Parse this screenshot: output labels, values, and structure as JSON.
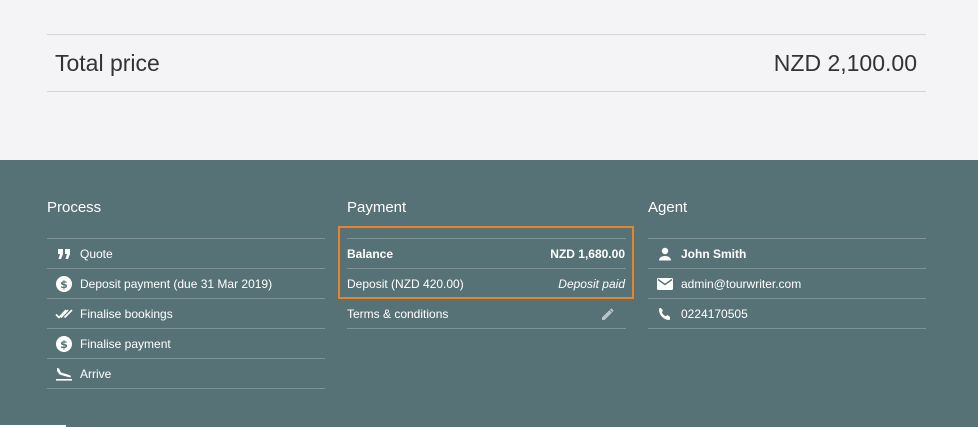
{
  "summary": {
    "total_label": "Total price",
    "total_value": "NZD 2,100.00"
  },
  "process": {
    "title": "Process",
    "items": [
      {
        "icon": "quote-icon",
        "label": "Quote"
      },
      {
        "icon": "dollar-circle-icon",
        "label": "Deposit payment (due 31 Mar 2019)"
      },
      {
        "icon": "double-check-icon",
        "label": "Finalise bookings"
      },
      {
        "icon": "dollar-circle-icon",
        "label": "Finalise payment"
      },
      {
        "icon": "plane-landing-icon",
        "label": "Arrive"
      }
    ]
  },
  "payment": {
    "title": "Payment",
    "balance_label": "Balance",
    "balance_value": "NZD 1,680.00",
    "deposit_label": "Deposit (NZD 420.00)",
    "deposit_status": "Deposit paid",
    "terms_label": "Terms & conditions"
  },
  "agent": {
    "title": "Agent",
    "name": "John Smith",
    "email": "admin@tourwriter.com",
    "phone": "0224170505"
  },
  "colors": {
    "footer_bg": "#577277",
    "highlight": "#e9832a",
    "page_bg": "#f4f4f6"
  }
}
